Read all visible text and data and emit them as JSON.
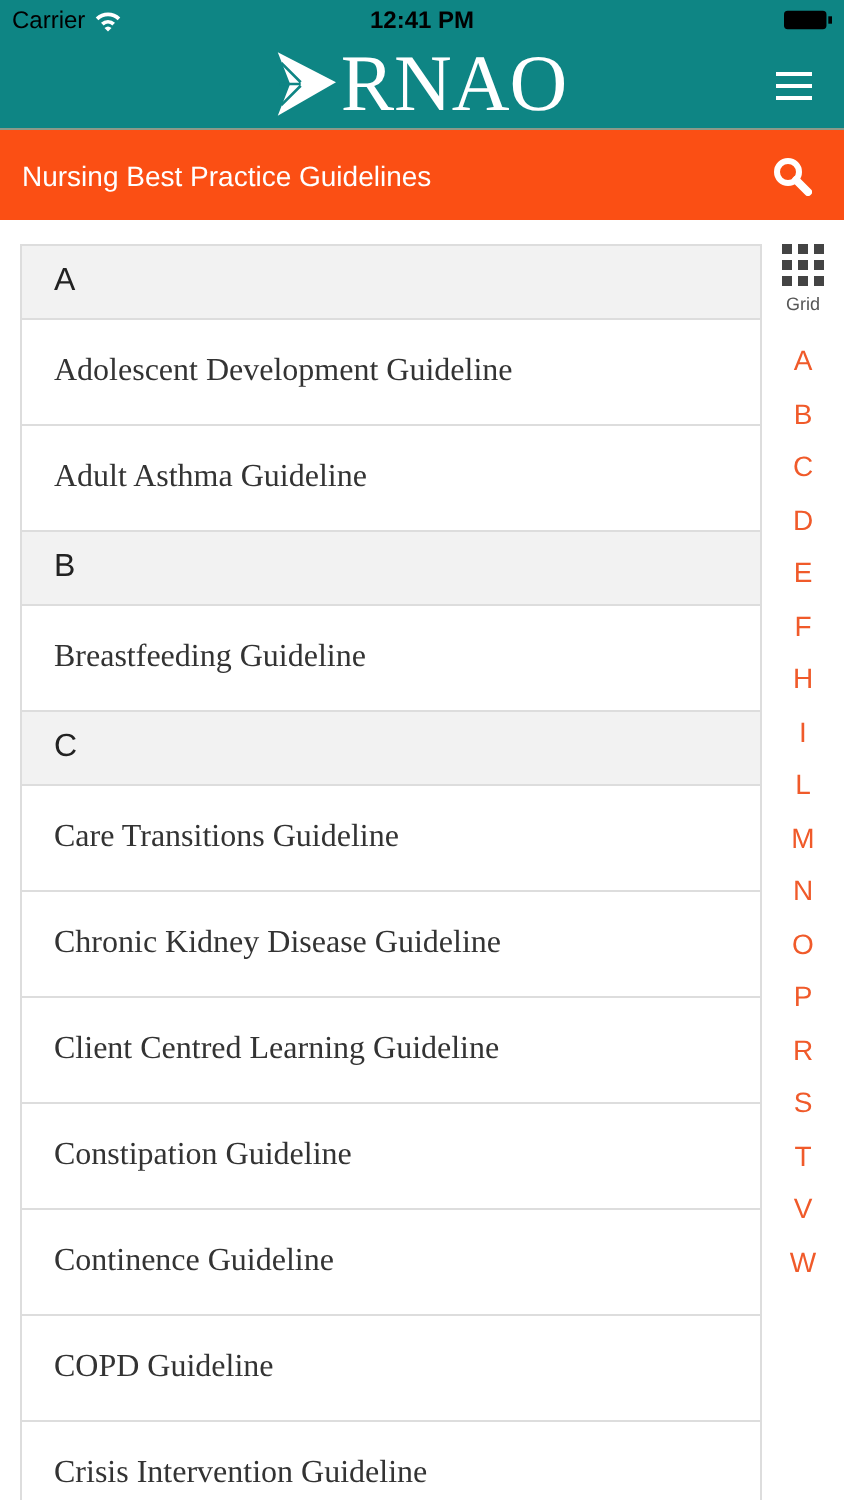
{
  "status_bar": {
    "carrier": "Carrier",
    "time": "12:41 PM"
  },
  "header": {
    "logo": "RNAO"
  },
  "title_bar": {
    "title": "Nursing Best Practice Guidelines"
  },
  "sections": [
    {
      "letter": "A",
      "items": [
        "Adolescent Development Guideline",
        "Adult Asthma Guideline"
      ]
    },
    {
      "letter": "B",
      "items": [
        "Breastfeeding Guideline"
      ]
    },
    {
      "letter": "C",
      "items": [
        "Care Transitions Guideline",
        "Chronic Kidney Disease Guideline",
        "Client Centred Learning Guideline",
        "Constipation Guideline",
        "Continence Guideline",
        "COPD Guideline",
        "Crisis Intervention Guideline"
      ]
    }
  ],
  "index": {
    "grid_label": "Grid",
    "letters": [
      "A",
      "B",
      "C",
      "D",
      "E",
      "F",
      "H",
      "I",
      "L",
      "M",
      "N",
      "O",
      "P",
      "R",
      "S",
      "T",
      "V",
      "W"
    ]
  }
}
